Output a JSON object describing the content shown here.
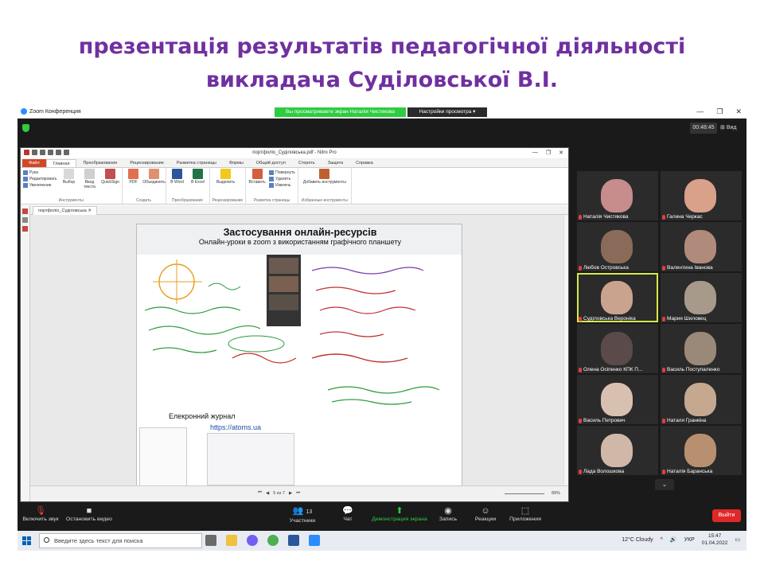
{
  "slide": {
    "title_line1": "презентація результатів педагогічної діяльності",
    "title_line2": "викладача Суділовської В.І."
  },
  "zoom": {
    "app_title": "Zoom Конференция",
    "viewing_banner": "Вы просматриваете экран Наталія Чистякова",
    "view_settings": "Настройки просмотра ▾",
    "timer": "00:48:45",
    "view_button": "Вид",
    "bottom": {
      "audio": "Включить звук",
      "video": "Остановить видео",
      "participants_count": "13",
      "participants": "Участники",
      "chat": "Чат",
      "share": "Демонстрация экрана",
      "record": "Запись",
      "reactions": "Реакции",
      "apps": "Приложения",
      "leave": "Выйти"
    },
    "participants": [
      {
        "name": "Наталія Чистякова",
        "color": "#c78c8c"
      },
      {
        "name": "Галина Черкас",
        "color": "#d9a08a"
      },
      {
        "name": "Любов Островська",
        "color": "#8a6b5a"
      },
      {
        "name": "Валентина Іванова",
        "color": "#b08a7a"
      },
      {
        "name": "Суділовська Вероніка",
        "color": "#c9a38e"
      },
      {
        "name": "Мария Шиловец",
        "color": "#a89a8a"
      },
      {
        "name": "Олена Осіпенко КПК П...",
        "color": "#5a4a4a"
      },
      {
        "name": "Василь Поступаленко",
        "color": "#9a8878"
      },
      {
        "name": "Василь Петрович",
        "color": "#d8c0b0"
      },
      {
        "name": "Наталя Гранкіна",
        "color": "#c4a890"
      },
      {
        "name": "Лада Волошкова",
        "color": "#d0b8a8"
      },
      {
        "name": "Наталія Баранська",
        "color": "#b89070"
      }
    ]
  },
  "nitro": {
    "window_title": "портфоліо_Суділовська.pdf - Nitro Pro",
    "tabs": [
      "Файл",
      "Главная",
      "Преобразование",
      "Рецензирование",
      "Разметка страницы",
      "Формы",
      "Общий доступ",
      "Стереть",
      "Защита",
      "Справка"
    ],
    "ribbon": {
      "hand": "Рука",
      "edit": "Редактировать",
      "zoom": "Увеличение",
      "select": "Выбор",
      "type_text": "Ввод текста",
      "quicksign": "QuickSign",
      "tools_group": "Инструменты",
      "pdf": "PDF",
      "combine": "Объединить",
      "create_group": "Создать",
      "to_word": "В Word",
      "to_excel": "В Excel",
      "convert_group": "Преобразование",
      "highlight": "Выделить",
      "review_group": "Рецензирование",
      "insert": "Вставить",
      "rotate": "Повернуть",
      "delete": "Удалить",
      "extract": "Извлечь",
      "page_layout_group": "Разметка страницы",
      "add_tools": "Добавить инструменты",
      "favorites_group": "Избранные инструменты"
    },
    "doc_tab": "портфоліо_Суділовська",
    "page_indicator": "5 из 7",
    "zoom_percent": "89%"
  },
  "page": {
    "heading": "Застосування онлайн-ресурсів",
    "subheading": "Онлайн-уроки в zoom з використанням графічного планшету",
    "journal_title": "Елекронний журнал",
    "journal_link": "https://atoms.ua"
  },
  "taskbar": {
    "search_placeholder": "Введите здесь текст для поиска",
    "weather": "12°C  Cloudy",
    "lang": "УКР",
    "time": "15:47",
    "date": "01.04.2022"
  }
}
